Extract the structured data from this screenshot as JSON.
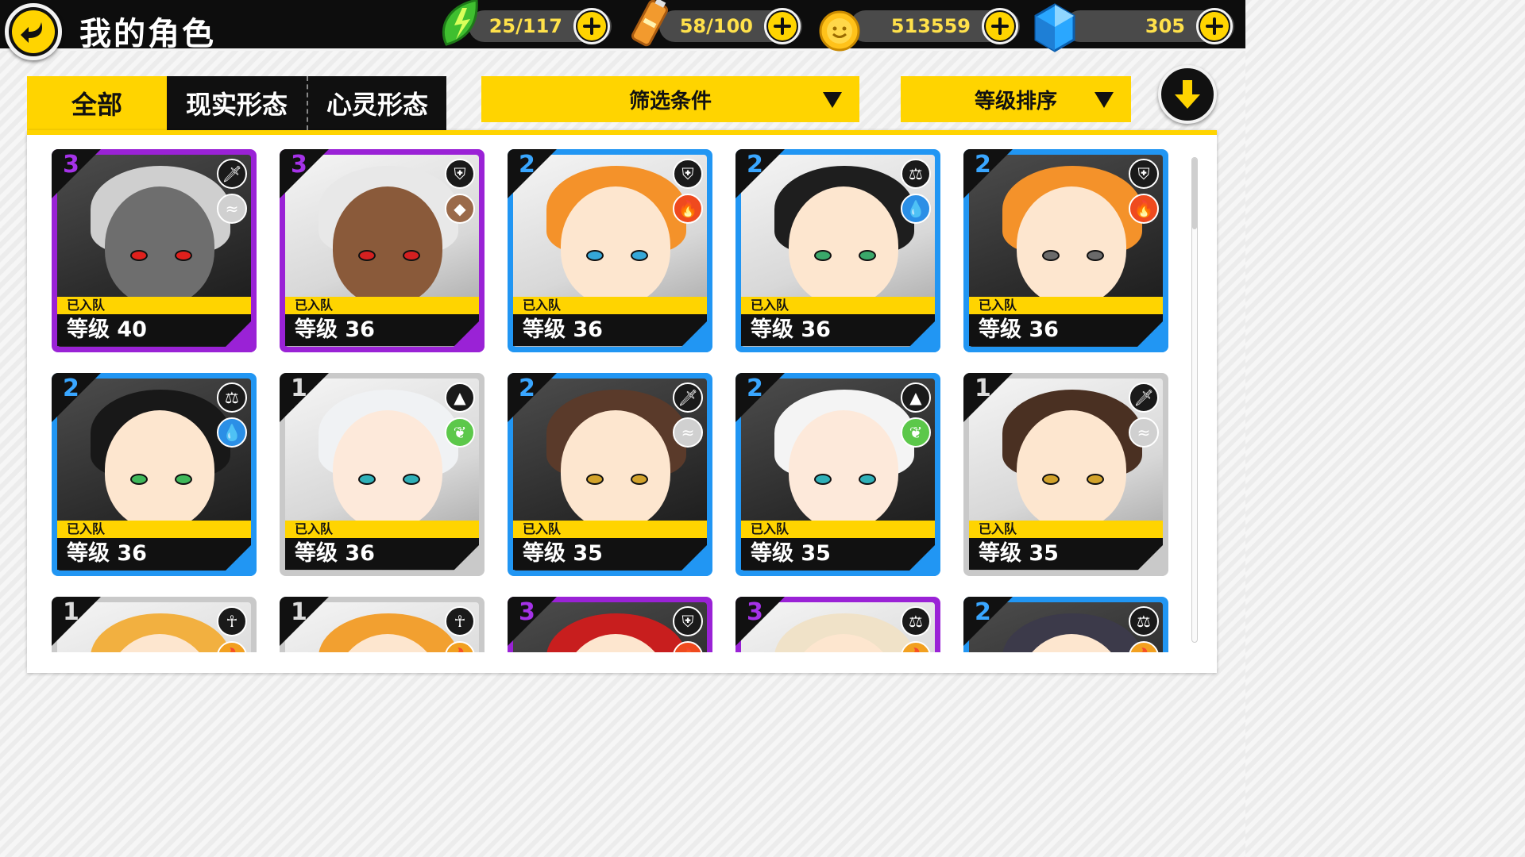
{
  "header": {
    "title": "我的角色",
    "resources": [
      {
        "id": "stamina",
        "value": "25/117",
        "icon": "lightning-leaf-icon",
        "color": "#3fbf2f"
      },
      {
        "id": "energy",
        "value": "58/100",
        "icon": "battery-icon",
        "color": "#f29a2e"
      },
      {
        "id": "coins",
        "value": "513559",
        "icon": "coin-icon",
        "color": "#ffc21a"
      },
      {
        "id": "gems",
        "value": "305",
        "icon": "blue-crystal-icon",
        "color": "#2aa7ff"
      }
    ]
  },
  "tabs": [
    {
      "label": "全部",
      "active": true
    },
    {
      "label": "现实形态",
      "active": false
    },
    {
      "label": "心灵形态",
      "active": false
    }
  ],
  "filters": {
    "filter_label": "筛选条件",
    "sort_label": "等级排序"
  },
  "cards": [
    {
      "rank": "3",
      "rarity": "purple",
      "class_icon": "sword-icon",
      "element_icon": "wind-icon",
      "element_color": "#d0d0d0",
      "team": "已入队",
      "level": "等级 40",
      "hair": "#cfcfcf",
      "skin": "#6e6e6e",
      "eye": "#e0201c",
      "dark": true
    },
    {
      "rank": "3",
      "rarity": "purple",
      "class_icon": "shield-icon",
      "element_icon": "earth-icon",
      "element_color": "#9a6a4a",
      "team": "已入队",
      "level": "等级 36",
      "hair": "#e8e8e8",
      "skin": "#8a5a3a",
      "eye": "#d42020",
      "dark": false
    },
    {
      "rank": "2",
      "rarity": "blue",
      "class_icon": "shield-icon",
      "element_icon": "fire-icon",
      "element_color": "#ef4a1e",
      "team": "已入队",
      "level": "等级 36",
      "hair": "#f4922a",
      "skin": "#fde6cf",
      "eye": "#35a7d8",
      "dark": false
    },
    {
      "rank": "2",
      "rarity": "blue",
      "class_icon": "balance-icon",
      "element_icon": "water-icon",
      "element_color": "#2b8fe6",
      "team": "已入队",
      "level": "等级 36",
      "hair": "#1e1e1e",
      "skin": "#fde6cf",
      "eye": "#3aa86a",
      "dark": false
    },
    {
      "rank": "2",
      "rarity": "blue",
      "class_icon": "shield-icon",
      "element_icon": "fire-icon",
      "element_color": "#ef4a1e",
      "team": "已入队",
      "level": "等级 36",
      "hair": "#f4922a",
      "skin": "#fde6cf",
      "eye": "#6a6a6a",
      "dark": true
    },
    {
      "rank": "2",
      "rarity": "blue",
      "class_icon": "balance-icon",
      "element_icon": "water-icon",
      "element_color": "#2b8fe6",
      "team": "已入队",
      "level": "等级 36",
      "hair": "#181818",
      "skin": "#fde6cf",
      "eye": "#3fb85a",
      "dark": true
    },
    {
      "rank": "1",
      "rarity": "grey",
      "class_icon": "triforce-icon",
      "element_icon": "leaf-icon",
      "element_color": "#5cc84a",
      "team": "已入队",
      "level": "等级 36",
      "hair": "#f0f2f4",
      "skin": "#fde9da",
      "eye": "#2fb0b8",
      "dark": false
    },
    {
      "rank": "2",
      "rarity": "blue",
      "class_icon": "sword-icon",
      "element_icon": "wind-icon",
      "element_color": "#d0d0d0",
      "team": "已入队",
      "level": "等级 35",
      "hair": "#5a3a2a",
      "skin": "#fde6cf",
      "eye": "#d2a22a",
      "dark": true
    },
    {
      "rank": "2",
      "rarity": "blue",
      "class_icon": "triforce-icon",
      "element_icon": "leaf-icon",
      "element_color": "#5cc84a",
      "team": "已入队",
      "level": "等级 35",
      "hair": "#f4f4f4",
      "skin": "#fde9da",
      "eye": "#2fb0b8",
      "dark": true
    },
    {
      "rank": "1",
      "rarity": "grey",
      "class_icon": "sword-icon",
      "element_icon": "wind-icon",
      "element_color": "#d0d0d0",
      "team": "已入队",
      "level": "等级 35",
      "hair": "#4a3022",
      "skin": "#fde6cf",
      "eye": "#d2a22a",
      "dark": false
    },
    {
      "rank": "1",
      "rarity": "grey",
      "class_icon": "ankh-icon",
      "element_icon": "fire-icon",
      "element_color": "#f2a020",
      "team": "",
      "level": "",
      "hair": "#f2b040",
      "skin": "#fde6cf",
      "eye": "#333333",
      "dark": false
    },
    {
      "rank": "1",
      "rarity": "grey",
      "class_icon": "ankh-icon",
      "element_icon": "fire-icon",
      "element_color": "#f2a020",
      "team": "",
      "level": "",
      "hair": "#f2a030",
      "skin": "#fde6cf",
      "eye": "#333333",
      "dark": false
    },
    {
      "rank": "3",
      "rarity": "purple",
      "class_icon": "shield-icon",
      "element_icon": "fire-icon",
      "element_color": "#ef4a1e",
      "team": "",
      "level": "",
      "hair": "#c81e1e",
      "skin": "#fde6cf",
      "eye": "#333333",
      "dark": true
    },
    {
      "rank": "3",
      "rarity": "purple",
      "class_icon": "balance-icon",
      "element_icon": "fire-icon",
      "element_color": "#f2a020",
      "team": "",
      "level": "",
      "hair": "#f0e2c8",
      "skin": "#fde6cf",
      "eye": "#333333",
      "dark": false
    },
    {
      "rank": "2",
      "rarity": "blue",
      "class_icon": "balance-icon",
      "element_icon": "fire-icon",
      "element_color": "#f2a020",
      "team": "",
      "level": "",
      "hair": "#3c3a4a",
      "skin": "#fde6cf",
      "eye": "#333333",
      "dark": true
    }
  ]
}
